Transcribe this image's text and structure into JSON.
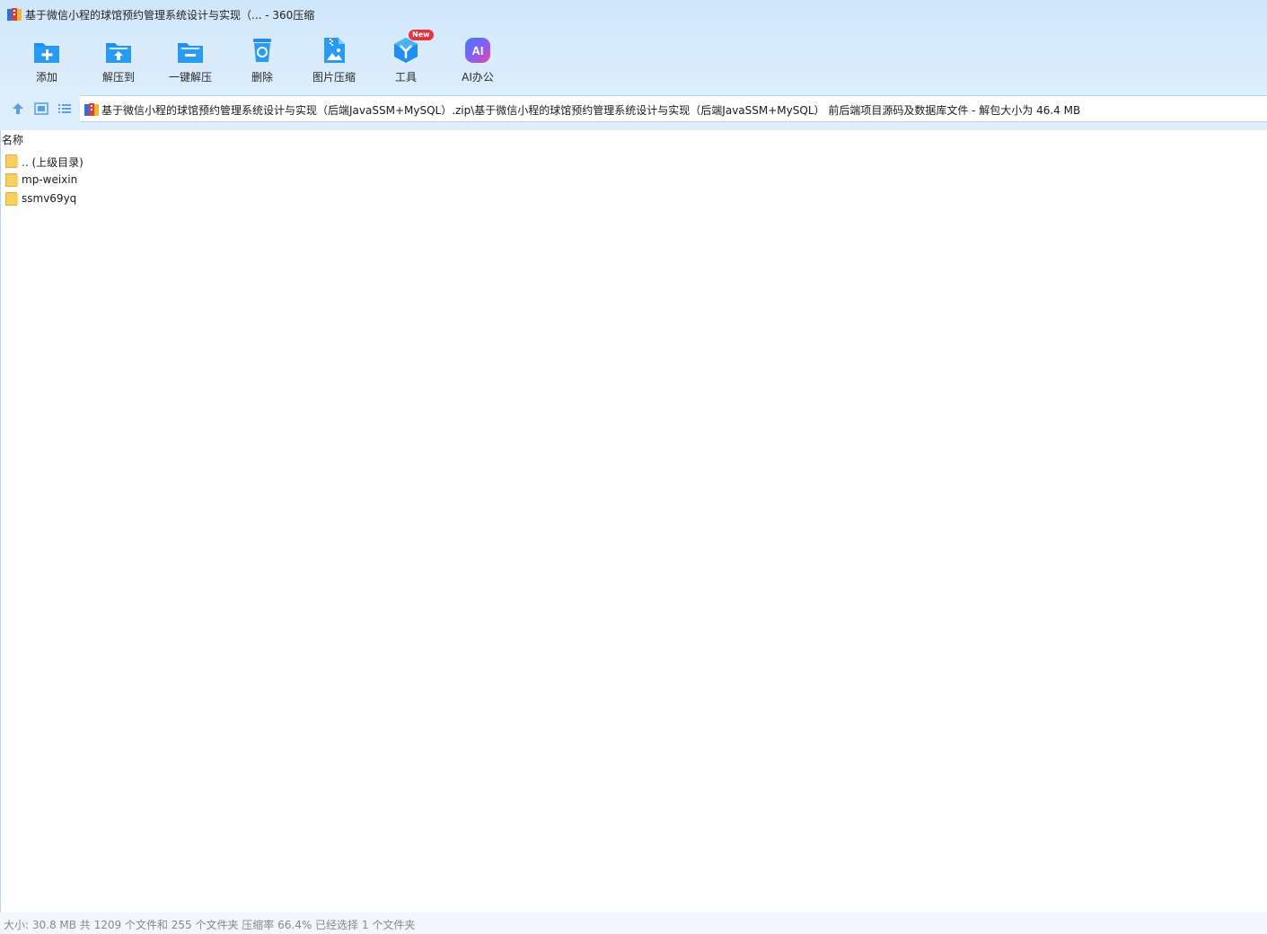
{
  "window": {
    "title": "基于微信小程的球馆预约管理系统设计与实现（... - 360压缩"
  },
  "toolbar": {
    "add": "添加",
    "extract_to": "解压到",
    "one_click_extract": "一键解压",
    "delete": "删除",
    "image_compress": "图片压缩",
    "tools": "工具",
    "tools_badge": "New",
    "ai_office": "AI办公",
    "ai_icon_text": "AI"
  },
  "path": {
    "text": "基于微信小程的球馆预约管理系统设计与实现（后端JavaSSM+MySQL）.zip\\基于微信小程的球馆预约管理系统设计与实现（后端JavaSSM+MySQL） 前后端项目源码及数据库文件 - 解包大小为 46.4 MB"
  },
  "filelist": {
    "column_name": "名称",
    "items": [
      {
        "name": ".. (上级目录)"
      },
      {
        "name": "mp-weixin"
      },
      {
        "name": "ssmv69yq"
      }
    ]
  },
  "status": {
    "text": "大小: 30.8 MB 共 1209 个文件和 255 个文件夹 压缩率 66.4% 已经选择 1 个文件夹"
  },
  "colors": {
    "accent": "#1e8ff0",
    "toolbar_bg": "#d9ecfc",
    "badge": "#e8313b",
    "folder": "#f7cf5e"
  }
}
